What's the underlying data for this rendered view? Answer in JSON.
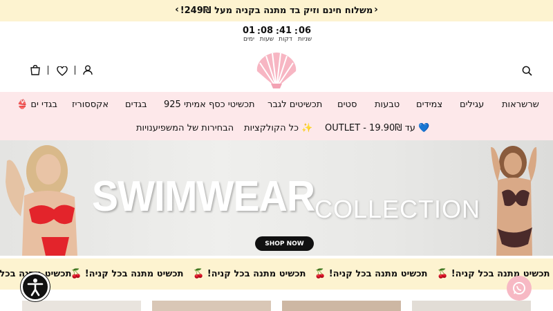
{
  "announcement": {
    "text": "משלוח חינם וזיק בד מתנה בקניה מעל 249₪!",
    "prev_icon": "chevron-left-icon",
    "next_icon": "chevron-right-icon"
  },
  "countdown": {
    "units": [
      {
        "value": "06",
        "label": "שניות"
      },
      {
        "value": "41",
        "label": "דקות"
      },
      {
        "value": "08",
        "label": "שעות"
      },
      {
        "value": "01",
        "label": "ימים"
      }
    ],
    "separator": ":"
  },
  "header": {
    "icons": [
      "search-icon",
      "account-icon",
      "wishlist-icon",
      "cart-icon"
    ],
    "logo": "seashell-logo"
  },
  "nav": {
    "row1": [
      "שרשראות",
      "עגילים",
      "צמידים",
      "טבעות",
      "סטים",
      "תכשיטים לגבר",
      "תכשיטי כסף אמיתי 925",
      "בגדים",
      "אקססוריז",
      "👙 בגדי ים"
    ],
    "row2": [
      "OUTLET - עד 19.90₪ 💙",
      "כל הקולקציות ✨",
      "הבחירות של המשפיענויות"
    ]
  },
  "hero": {
    "title": "SWIMWEAR",
    "subtitle": "COLLECTION",
    "cta": "SHOP NOW"
  },
  "marquee": {
    "items": [
      "תכשיט מתנה בכל קניה! 🍒",
      "תכשיט מתנה בכל קניה! 🍒",
      "תכשיט מתנה בכל קניה! 🍒",
      "תכשיט מתנה בכל קניה! 🍒",
      "תכשיט מתנה בכל קניה! 🍒"
    ]
  },
  "floating": {
    "accessibility_icon": "accessibility-icon",
    "whatsapp_icon": "whatsapp-icon"
  },
  "colors": {
    "announcement_bg": "#fdf3d0",
    "nav_bg": "#fde8ea",
    "logo_pink": "#f7b6c3",
    "accent": "#111111"
  }
}
